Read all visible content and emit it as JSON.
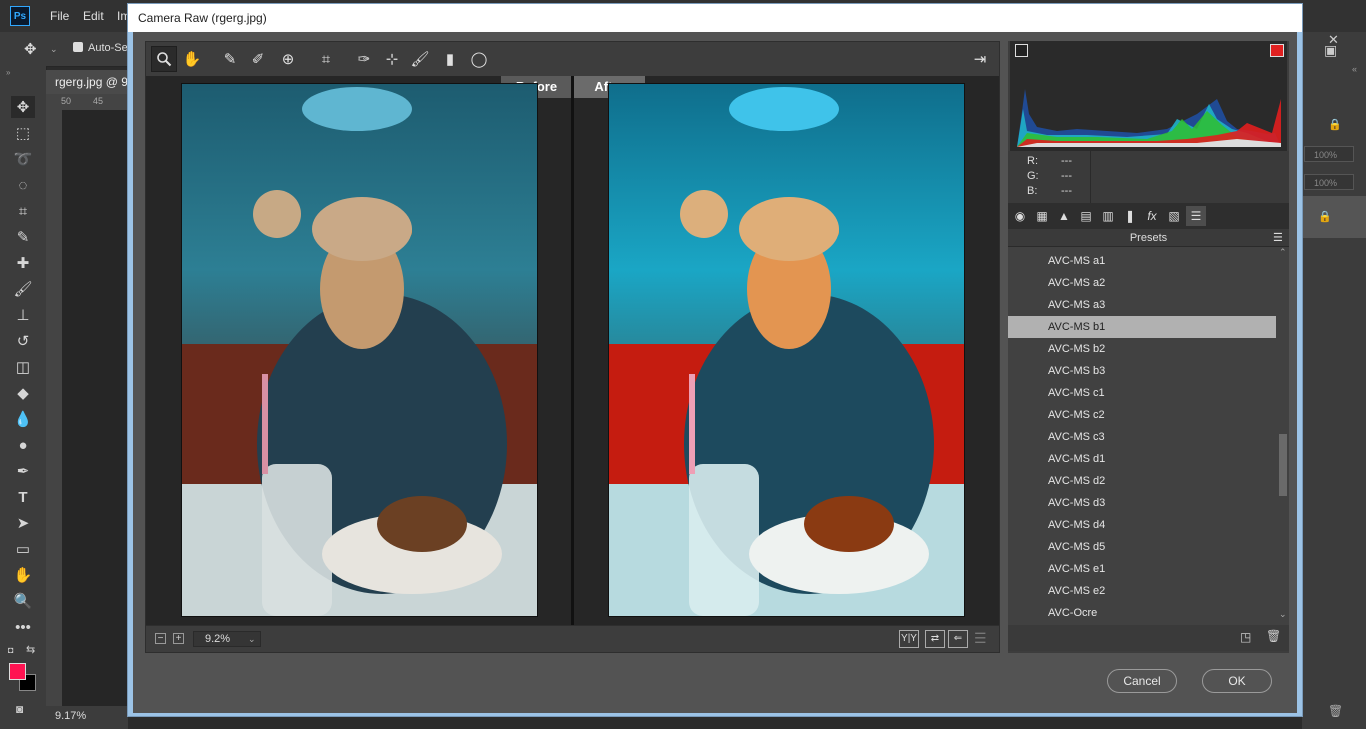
{
  "ps": {
    "logo": "Ps",
    "menus": [
      "File",
      "Edit",
      "Im"
    ],
    "options_bar": {
      "auto_select": "Auto-Sel"
    },
    "doc_tab": "rgerg.jpg @ 9",
    "ruler_ticks": [
      "50",
      "45"
    ],
    "status_zoom": "9.17%",
    "right_fields": [
      "100%",
      "100%"
    ]
  },
  "dialog": {
    "title": "Camera Raw (rgerg.jpg)",
    "before_label": "Before",
    "after_label": "After",
    "zoom_value": "9.2%",
    "view_buttons": [
      "Y|Y",
      "⇄",
      "⇐"
    ],
    "rgb": {
      "r_label": "R:",
      "g_label": "G:",
      "b_label": "B:",
      "r_value": "---",
      "g_value": "---",
      "b_value": "---"
    },
    "presets_title": "Presets",
    "presets": [
      "AVC-MS a1",
      "AVC-MS a2",
      "AVC-MS a3",
      "AVC-MS b1",
      "AVC-MS b2",
      "AVC-MS b3",
      "AVC-MS c1",
      "AVC-MS c2",
      "AVC-MS c3",
      "AVC-MS d1",
      "AVC-MS d2",
      "AVC-MS d3",
      "AVC-MS d4",
      "AVC-MS d5",
      "AVC-MS e1",
      "AVC-MS e2",
      "AVC-Ocre"
    ],
    "selected_preset": "AVC-MS b1",
    "cancel_label": "Cancel",
    "ok_label": "OK"
  },
  "colors": {
    "foreground": "#ff1452",
    "background": "#000000",
    "selection": "#b1b1b1"
  }
}
